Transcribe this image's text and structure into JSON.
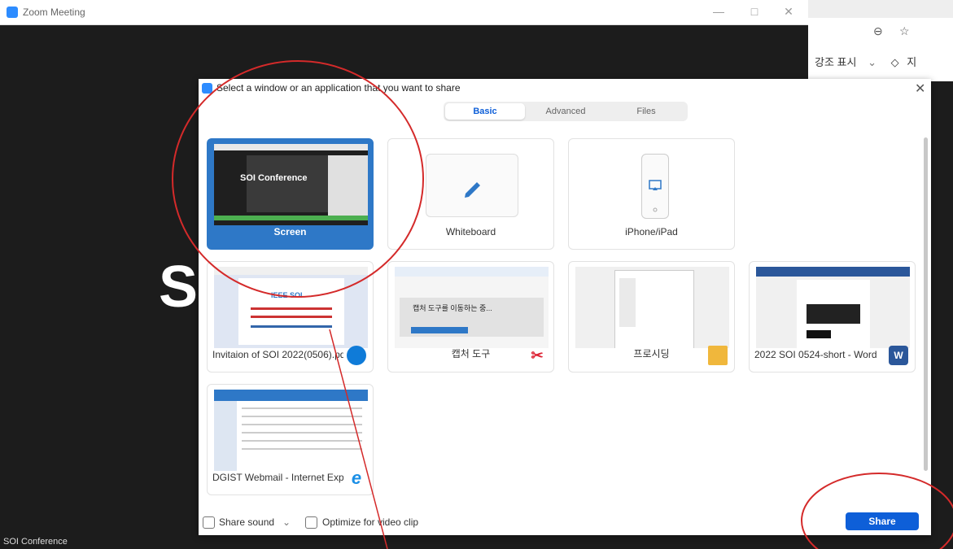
{
  "window": {
    "title": "Zoom Meeting",
    "min_glyph": "—",
    "max_glyph": "□",
    "close_glyph": "✕",
    "big_letter": "S",
    "participant_name": "SOI Conference"
  },
  "background_window": {
    "highlight_label": "강조 표시",
    "dropdown_glyph": "⌄",
    "extra_char": "지"
  },
  "dialog": {
    "title": "Select a window or an application that you want to share",
    "close_glyph": "✕",
    "tabs": [
      "Basic",
      "Advanced",
      "Files"
    ],
    "active_tab": "Basic",
    "tiles": [
      {
        "label": "Screen",
        "thumb_text": "SOI Conference",
        "icon": "monitor-icon"
      },
      {
        "label": "Whiteboard",
        "icon": "pencil-icon"
      },
      {
        "label": "iPhone/iPad",
        "icon": "airplay-icon"
      },
      {
        "label": "Invitaion of SOI 2022(0506).pdf - ...",
        "icon": "edge-icon",
        "thumb_text": "IEEE SOI"
      },
      {
        "label": "캡처 도구",
        "icon": "snipping-tool-icon",
        "thumb_text": "캡처 도구를 이동하는 중..."
      },
      {
        "label": "프로시딩",
        "icon": "folder-icon"
      },
      {
        "label": "2022 SOI 0524-short - Word",
        "icon": "word-icon",
        "icon_text": "W"
      },
      {
        "label": "DGIST Webmail - Internet Explorer",
        "icon": "ie-icon",
        "icon_text": "e"
      }
    ],
    "footer": {
      "share_sound": "Share sound",
      "share_sound_dropdown": "⌄",
      "optimize": "Optimize for video clip",
      "share_button": "Share"
    }
  },
  "colors": {
    "accent": "#0e5fd8",
    "selected_tile": "#2e78c7",
    "annotation": "#d42a2a"
  }
}
